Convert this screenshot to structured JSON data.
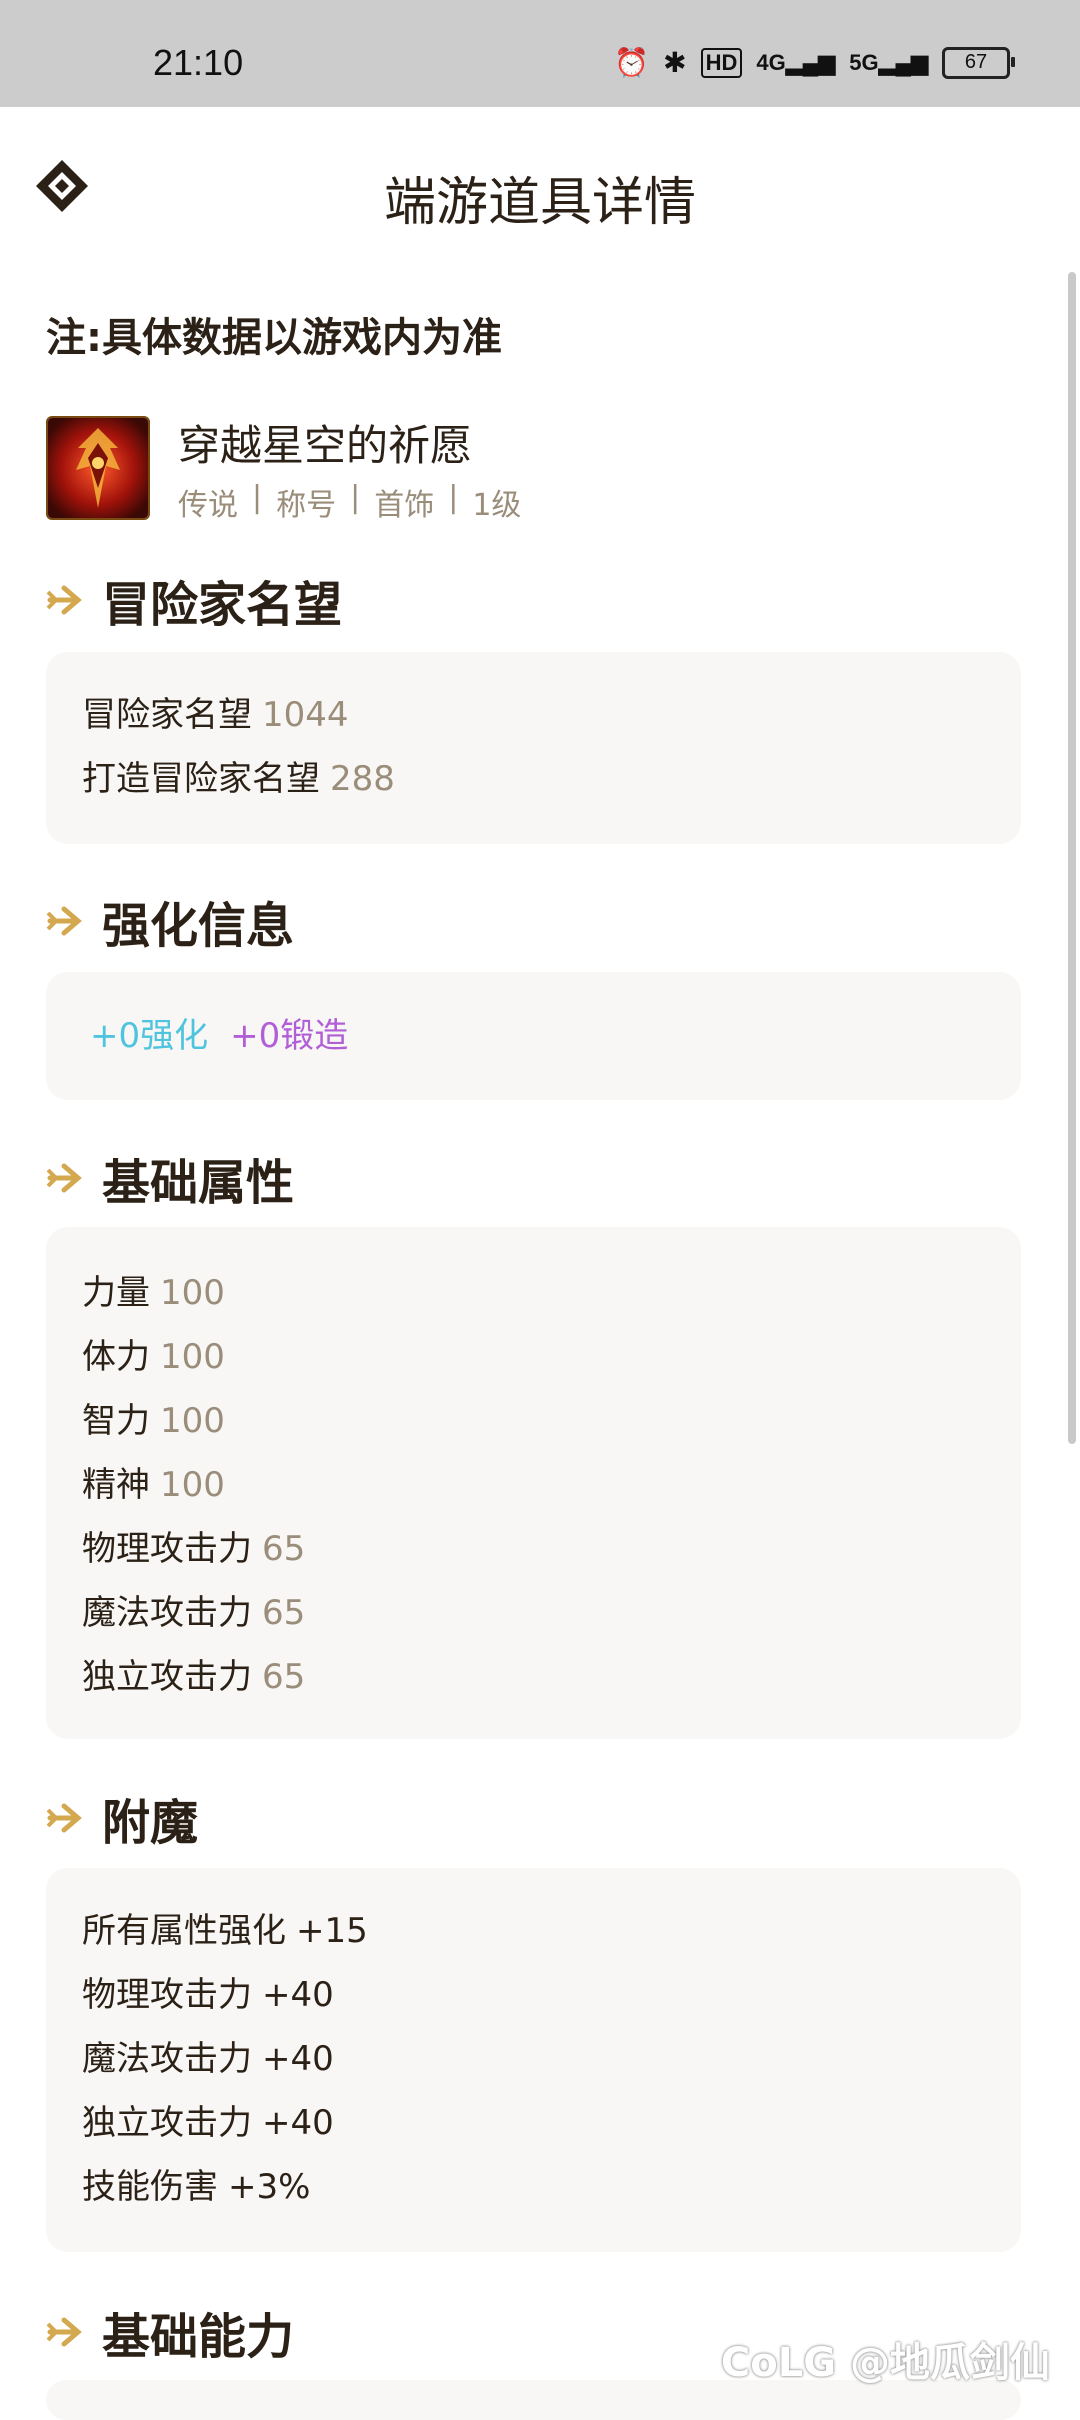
{
  "status_bar": {
    "time": "21:10",
    "icons": [
      "alarm-icon",
      "bluetooth-icon",
      "hd-icon",
      "4g-signal-icon",
      "5g-signal-icon"
    ],
    "hd": "HD",
    "net1": "4G",
    "net2": "5G",
    "battery": "67"
  },
  "header": {
    "title": "端游道具详情"
  },
  "note": "注:具体数据以游戏内为准",
  "item": {
    "name": "穿越星空的祈愿",
    "tags": [
      "传说",
      "称号",
      "首饰",
      "1级"
    ]
  },
  "sections": {
    "reputation": {
      "title": "冒险家名望",
      "rows": [
        {
          "label": "冒险家名望",
          "value": "1044"
        },
        {
          "label": "打造冒险家名望",
          "value": "288"
        }
      ]
    },
    "enhance": {
      "title": "强化信息",
      "reinforce": "+0强化",
      "forge": "+0锻造"
    },
    "base_attrs": {
      "title": "基础属性",
      "rows": [
        {
          "label": "力量",
          "value": "100"
        },
        {
          "label": "体力",
          "value": "100"
        },
        {
          "label": "智力",
          "value": "100"
        },
        {
          "label": "精神",
          "value": "100"
        },
        {
          "label": "物理攻击力",
          "value": "65"
        },
        {
          "label": "魔法攻击力",
          "value": "65"
        },
        {
          "label": "独立攻击力",
          "value": "65"
        }
      ]
    },
    "enchant": {
      "title": "附魔",
      "rows": [
        {
          "label": "所有属性强化",
          "value": "+15"
        },
        {
          "label": "物理攻击力",
          "value": "+40"
        },
        {
          "label": "魔法攻击力",
          "value": "+40"
        },
        {
          "label": "独立攻击力",
          "value": "+40"
        },
        {
          "label": "技能伤害",
          "value": "+3%"
        }
      ]
    },
    "base_ability": {
      "title": "基础能力"
    }
  },
  "watermark": "CoLG @地瓜剑仙",
  "colors": {
    "accent": "#d4a84f",
    "value_text": "#9a8d7a",
    "cyan": "#4fc4df",
    "purple": "#b15fd6"
  }
}
